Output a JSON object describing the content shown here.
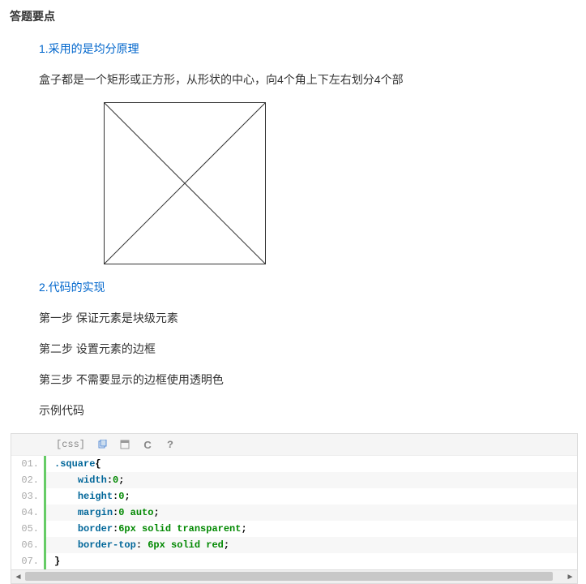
{
  "title": "答题要点",
  "sections": {
    "s1": {
      "heading": "1.采用的是均分原理",
      "desc": "盒子都是一个矩形或正方形，从形状的中心，向4个角上下左右划分4个部"
    },
    "s2": {
      "heading": "2.代码的实现",
      "step1": "第一步 保证元素是块级元素",
      "step2": "第二步 设置元素的边框",
      "step3": "第三步 不需要显示的边框使用透明色",
      "example_label": "示例代码"
    }
  },
  "code": {
    "lang": "[css]",
    "lines": [
      {
        "n": "01.",
        "raw": ".square{",
        "tokens": [
          [
            "sel",
            ".square"
          ],
          [
            "punc",
            "{"
          ]
        ]
      },
      {
        "n": "02.",
        "raw": "    width:0;",
        "tokens": [
          [
            "ws",
            "    "
          ],
          [
            "prop",
            "width"
          ],
          [
            "punc",
            ":"
          ],
          [
            "val",
            "0"
          ],
          [
            "punc",
            ";"
          ]
        ]
      },
      {
        "n": "03.",
        "raw": "    height:0;",
        "tokens": [
          [
            "ws",
            "    "
          ],
          [
            "prop",
            "height"
          ],
          [
            "punc",
            ":"
          ],
          [
            "val",
            "0"
          ],
          [
            "punc",
            ";"
          ]
        ]
      },
      {
        "n": "04.",
        "raw": "    margin:0 auto;",
        "tokens": [
          [
            "ws",
            "    "
          ],
          [
            "prop",
            "margin"
          ],
          [
            "punc",
            ":"
          ],
          [
            "val",
            "0 auto"
          ],
          [
            "punc",
            ";"
          ]
        ]
      },
      {
        "n": "05.",
        "raw": "    border:6px solid transparent;",
        "tokens": [
          [
            "ws",
            "    "
          ],
          [
            "prop",
            "border"
          ],
          [
            "punc",
            ":"
          ],
          [
            "val",
            "6px solid transparent"
          ],
          [
            "punc",
            ";"
          ]
        ]
      },
      {
        "n": "06.",
        "raw": "    border-top: 6px solid red;",
        "tokens": [
          [
            "ws",
            "    "
          ],
          [
            "prop",
            "border-top"
          ],
          [
            "punc",
            ": "
          ],
          [
            "val",
            "6px solid red"
          ],
          [
            "punc",
            ";"
          ]
        ]
      },
      {
        "n": "07.",
        "raw": "}",
        "tokens": [
          [
            "punc",
            "}"
          ]
        ]
      }
    ]
  },
  "toolbar_icons": {
    "copy": "copy-icon",
    "open": "open-icon",
    "undo": "undo-icon",
    "help": "help-icon"
  }
}
